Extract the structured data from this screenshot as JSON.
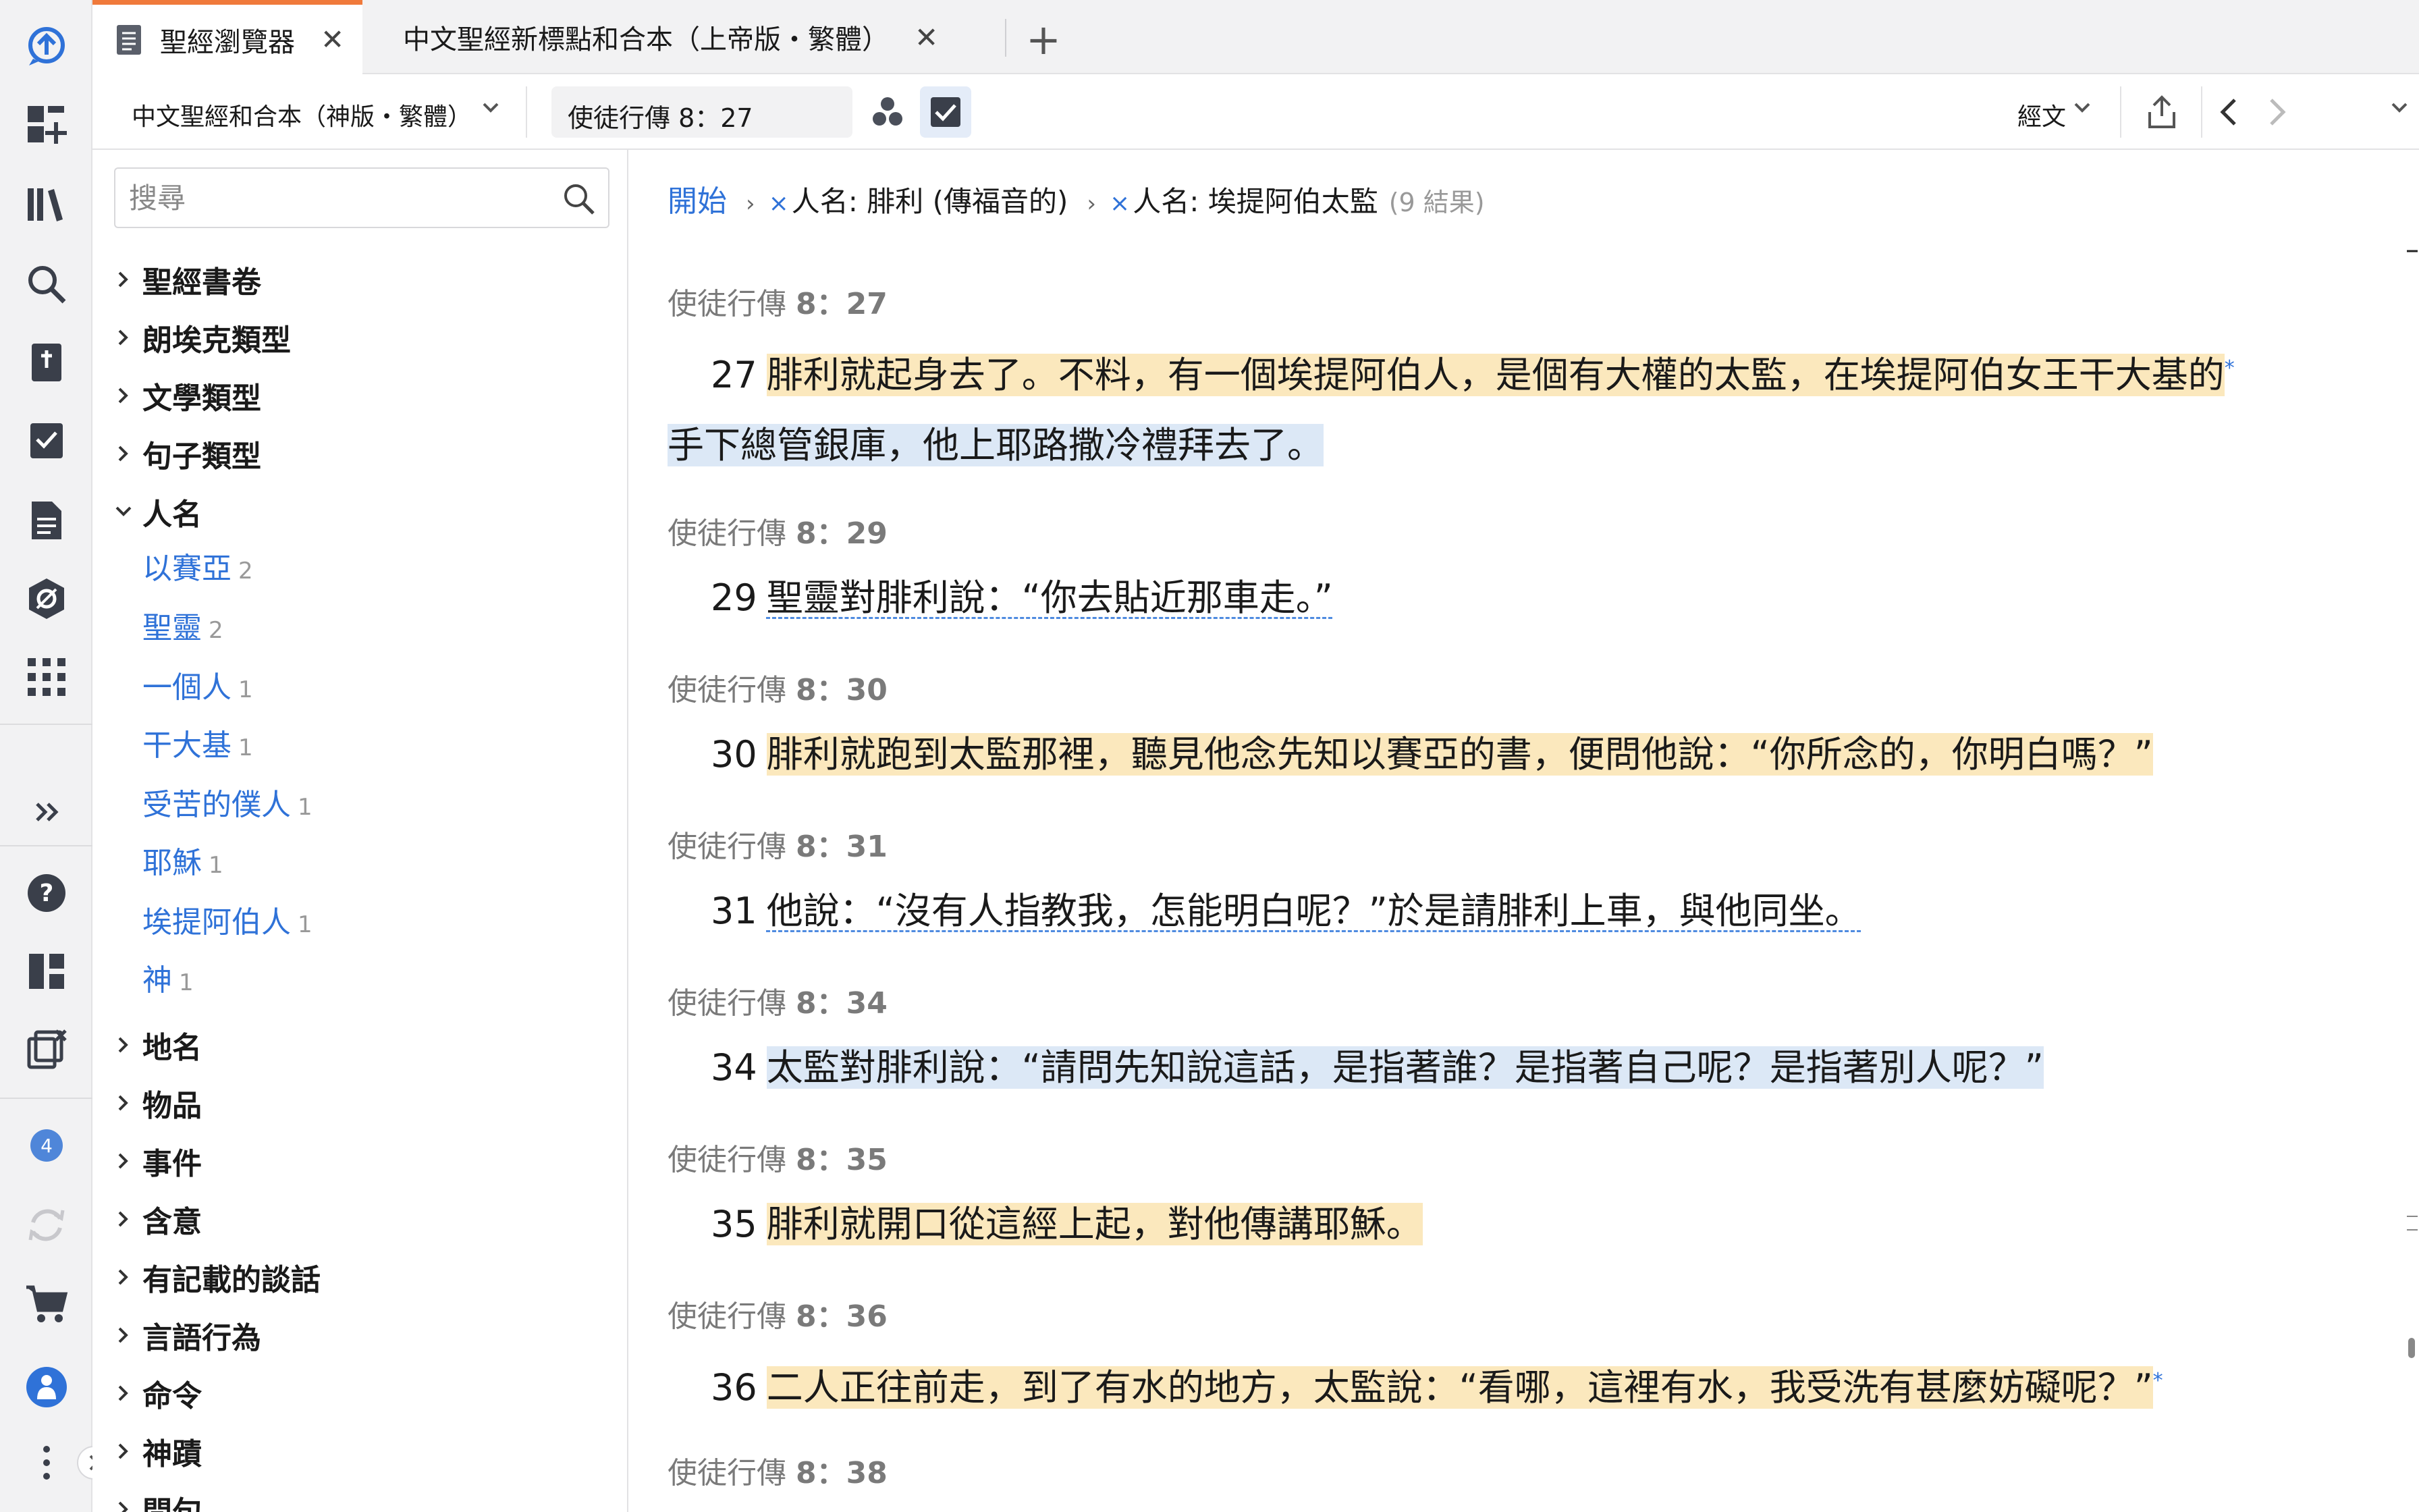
{
  "tabs": [
    {
      "label": "聖經瀏覽器",
      "active": true
    },
    {
      "label": "中文聖經新標點和合本（上帝版・繁體）",
      "active": false
    }
  ],
  "toolbar": {
    "bible_version": "中文聖經和合本（神版・繁體）",
    "reference": "使徒行傳 8：27",
    "view_mode": "經文"
  },
  "sidebar": {
    "search_placeholder": "搜尋",
    "categories": [
      {
        "label": "聖經書卷",
        "expanded": false
      },
      {
        "label": "朗埃克類型",
        "expanded": false
      },
      {
        "label": "文學類型",
        "expanded": false
      },
      {
        "label": "句子類型",
        "expanded": false
      },
      {
        "label": "人名",
        "expanded": true,
        "children": [
          {
            "label": "以賽亞",
            "count": "2"
          },
          {
            "label": "聖靈",
            "count": "2"
          },
          {
            "label": "一個人",
            "count": "1"
          },
          {
            "label": "干大基",
            "count": "1"
          },
          {
            "label": "受苦的僕人",
            "count": "1"
          },
          {
            "label": "耶穌",
            "count": "1"
          },
          {
            "label": "埃提阿伯人",
            "count": "1"
          },
          {
            "label": "神",
            "count": "1"
          }
        ]
      },
      {
        "label": "地名",
        "expanded": false
      },
      {
        "label": "物品",
        "expanded": false
      },
      {
        "label": "事件",
        "expanded": false
      },
      {
        "label": "含意",
        "expanded": false
      },
      {
        "label": "有記載的談話",
        "expanded": false
      },
      {
        "label": "言語行為",
        "expanded": false
      },
      {
        "label": "命令",
        "expanded": false
      },
      {
        "label": "神蹟",
        "expanded": false
      },
      {
        "label": "問句",
        "expanded": false
      }
    ]
  },
  "breadcrumb": {
    "start": "開始",
    "filters": [
      "人名: 腓利 (傳福音的)",
      "人名: 埃提阿伯太監"
    ],
    "results": "(9 結果)"
  },
  "verses": [
    {
      "ref_book": "使徒行傳",
      "ref_num": "8：27",
      "number": "27",
      "line1": "腓利就起身去了。不料，有一個埃提阿伯人，是個有大權的太監，在埃提阿伯女王干大基的",
      "line2": "手下總管銀庫，他上耶路撒冷禮拜去了。"
    },
    {
      "ref_book": "使徒行傳",
      "ref_num": "8：29",
      "number": "29",
      "line1": "聖靈對腓利說：“你去貼近那車走。”"
    },
    {
      "ref_book": "使徒行傳",
      "ref_num": "8：30",
      "number": "30",
      "line1": "腓利就跑到太監那裡，聽見他念先知以賽亞的書，便問他說：“你所念的，你明白嗎？”"
    },
    {
      "ref_book": "使徒行傳",
      "ref_num": "8：31",
      "number": "31",
      "line1": "他說：“沒有人指教我，怎能明白呢？”於是請腓利上車，與他同坐。"
    },
    {
      "ref_book": "使徒行傳",
      "ref_num": "8：34",
      "number": "34",
      "line1": "太監對腓利說：“請問先知說這話，是指著誰？是指著自己呢？是指著別人呢？”"
    },
    {
      "ref_book": "使徒行傳",
      "ref_num": "8：35",
      "number": "35",
      "line1": "腓利就開口從這經上起，對他傳講耶穌。"
    },
    {
      "ref_book": "使徒行傳",
      "ref_num": "8：36",
      "number": "36",
      "line1": "二人正往前走，到了有水的地方，太監說：“看哪，這裡有水，我受洗有甚麼妨礙呢？”"
    },
    {
      "ref_book": "使徒行傳",
      "ref_num": "8：38"
    }
  ],
  "notifications_count": "4",
  "colors": {
    "accent": "#2f72d8",
    "tab_active": "#f07a3b",
    "highlight_person": "#fbe8bd",
    "highlight_secondary": "#dce8f6"
  }
}
